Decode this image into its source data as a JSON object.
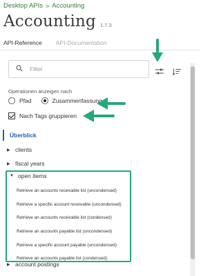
{
  "breadcrumb": {
    "root": "Desktop APIs",
    "separator": ">",
    "current": "Accounting"
  },
  "header": {
    "title": "Accounting",
    "version": "1.7.3"
  },
  "tabs": [
    {
      "label": "API-Reference",
      "active": true
    },
    {
      "label": "API-Documentation",
      "active": false
    }
  ],
  "search": {
    "placeholder": "Filter",
    "value": ""
  },
  "options": {
    "label": "Operationen anzeigen nach",
    "radios": [
      {
        "label": "Pfad",
        "checked": false
      },
      {
        "label": "Zusammenfassung",
        "checked": true
      }
    ],
    "group_by_tags": {
      "label": "Nach Tags gruppieren",
      "checked": true
    }
  },
  "tree": {
    "overview": "Überblick",
    "items": [
      {
        "label": "clients",
        "expanded": false
      },
      {
        "label": "fiscal years",
        "expanded": false
      }
    ],
    "open_group": {
      "label": "open items",
      "expanded": true,
      "operations": [
        "Retrieve an accounts receivable list (uncondensed)",
        "Retrieve a specific account receivable (uncondensed)",
        "Retrieve an accounts receivable list (condensed)",
        "Retrieve an accounts payable list (uncondensed)",
        "Retrieve a specific account payable (uncondensed)",
        "Retrieve an accounts payable list (condensed)"
      ]
    },
    "last_item": {
      "label": "account postings",
      "expanded": false
    }
  },
  "colors": {
    "breadcrumb": "#3a7a3a",
    "highlight": "#25a879",
    "active_link": "#1f5fb0"
  },
  "icons": {
    "search": "search-icon",
    "filter_settings": "sliders-icon",
    "sort": "sort-icon",
    "caret_collapsed": "caret-right-icon",
    "caret_expanded": "caret-down-icon"
  }
}
